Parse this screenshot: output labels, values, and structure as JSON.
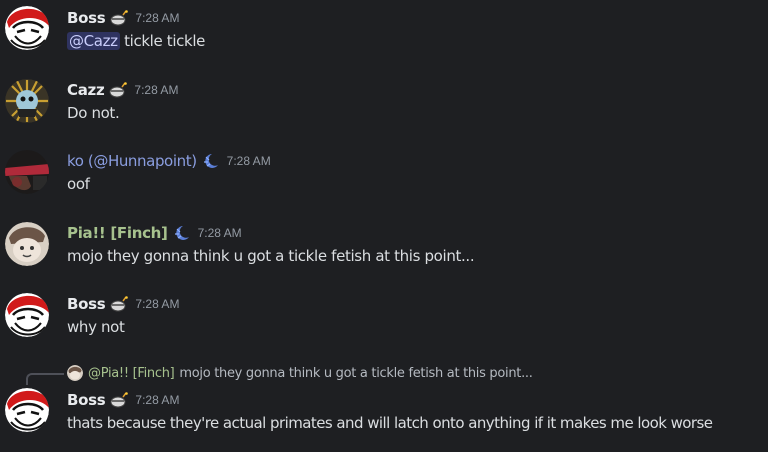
{
  "colors": {
    "background": "#1e1f22",
    "boss": "#e8eaed",
    "cazz": "#e8eaed",
    "ko": "#8a9ddf",
    "pia": "#a7c28e",
    "mention_bg": "#3b3f75",
    "timestamp": "#949ba4"
  },
  "messages": [
    {
      "username": "Boss",
      "badge_icon": "bomb-badge-icon",
      "timestamp": "7:28 AM",
      "mention": "@Cazz",
      "text": " tickle tickle"
    },
    {
      "username": "Cazz",
      "badge_icon": "bomb-badge-icon",
      "timestamp": "7:28 AM",
      "text": "Do not."
    },
    {
      "username": "ko (@Hunnapoint)",
      "badge_icon": "crescent-badge-icon",
      "timestamp": "7:28 AM",
      "text": "oof"
    },
    {
      "username": "Pia!! [Finch]",
      "badge_icon": "crescent-badge-icon",
      "timestamp": "7:28 AM",
      "text": "mojo they gonna think u got a tickle fetish at this point..."
    },
    {
      "username": "Boss",
      "badge_icon": "bomb-badge-icon",
      "timestamp": "7:28 AM",
      "text": "why not"
    },
    {
      "reply": {
        "username": "@Pia!! [Finch]",
        "text": "mojo they gonna think u got a tickle fetish at this point..."
      },
      "username": "Boss",
      "badge_icon": "bomb-badge-icon",
      "timestamp": "7:28 AM",
      "text": "thats because they're actual primates and will latch onto anything if it makes me look worse"
    }
  ]
}
